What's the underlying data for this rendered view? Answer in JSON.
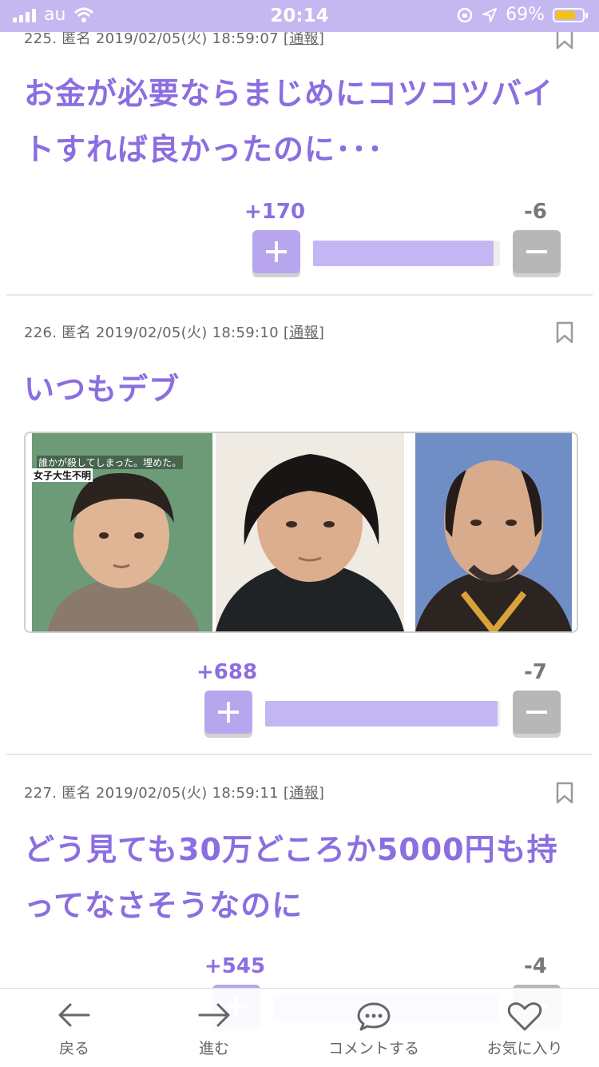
{
  "status_bar": {
    "carrier": "au",
    "time": "20:14",
    "battery": "69%"
  },
  "posts": [
    {
      "meta": "225. 匿名 2019/02/05(火) 18:59:07 ",
      "report": "[通報]",
      "text_lines": [
        "お金が必要ならまじめにコツコツバイ",
        "トすれば良かったのに･･･"
      ],
      "plus": "+170",
      "minus": "-6",
      "ratio": 0.966
    },
    {
      "meta": "226. 匿名 2019/02/05(火) 18:59:10 ",
      "report": "[通報]",
      "text_lines": [
        "いつもデブ"
      ],
      "image_caption_1": "誰かが殺してしまった。埋めた。",
      "image_caption_2": "女子大生不明",
      "plus": "+688",
      "minus": "-7",
      "ratio": 0.99
    },
    {
      "meta": "227. 匿名 2019/02/05(火) 18:59:11 ",
      "report": "[通報]",
      "text_lines": [
        "どう見ても30万どころか5000円も持",
        "ってなさそうなのに"
      ],
      "plus": "+545",
      "minus": "-4",
      "ratio": 0.993
    }
  ],
  "tab_bar": {
    "back": "戻る",
    "forward": "進む",
    "comment": "コメントする",
    "favorite": "お気に入り"
  },
  "colors": {
    "accent": "#8b6ee0",
    "status_bar": "#c5b8f0",
    "plus_button": "#b7a6ee",
    "minus_button": "#b7b7b7",
    "bar_fill": "#c4b6f3"
  },
  "icons": [
    "signal-icon",
    "wifi-icon",
    "orientation-lock-icon",
    "location-icon",
    "battery-icon",
    "bookmark-icon",
    "plus-icon",
    "minus-icon",
    "back-arrow-icon",
    "forward-arrow-icon",
    "comment-bubble-icon",
    "heart-icon"
  ]
}
